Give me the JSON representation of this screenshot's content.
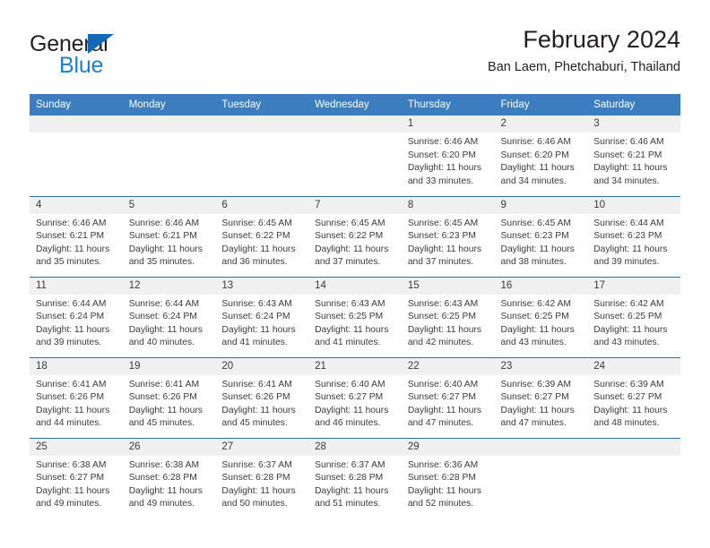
{
  "brand": {
    "name_top": "General",
    "name_bottom": "Blue",
    "accent_color": "#1b7fd4",
    "triangle_color": "#1268b3"
  },
  "header": {
    "title": "February 2024",
    "subtitle": "Ban Laem, Phetchaburi, Thailand"
  },
  "theme": {
    "header_row_bg": "#3b7dbf",
    "row_divider": "#2e6fa8",
    "daynum_bg": "#f0f0f0",
    "text": "#3a3a3a"
  },
  "weekday_headers": [
    "Sunday",
    "Monday",
    "Tuesday",
    "Wednesday",
    "Thursday",
    "Friday",
    "Saturday"
  ],
  "weeks": [
    [
      {
        "day": "",
        "blank": true
      },
      {
        "day": "",
        "blank": true
      },
      {
        "day": "",
        "blank": true
      },
      {
        "day": "",
        "blank": true
      },
      {
        "day": "1",
        "sunrise": "Sunrise: 6:46 AM",
        "sunset": "Sunset: 6:20 PM",
        "daylight": "Daylight: 11 hours and 33 minutes."
      },
      {
        "day": "2",
        "sunrise": "Sunrise: 6:46 AM",
        "sunset": "Sunset: 6:20 PM",
        "daylight": "Daylight: 11 hours and 34 minutes."
      },
      {
        "day": "3",
        "sunrise": "Sunrise: 6:46 AM",
        "sunset": "Sunset: 6:21 PM",
        "daylight": "Daylight: 11 hours and 34 minutes."
      }
    ],
    [
      {
        "day": "4",
        "sunrise": "Sunrise: 6:46 AM",
        "sunset": "Sunset: 6:21 PM",
        "daylight": "Daylight: 11 hours and 35 minutes."
      },
      {
        "day": "5",
        "sunrise": "Sunrise: 6:46 AM",
        "sunset": "Sunset: 6:21 PM",
        "daylight": "Daylight: 11 hours and 35 minutes."
      },
      {
        "day": "6",
        "sunrise": "Sunrise: 6:45 AM",
        "sunset": "Sunset: 6:22 PM",
        "daylight": "Daylight: 11 hours and 36 minutes."
      },
      {
        "day": "7",
        "sunrise": "Sunrise: 6:45 AM",
        "sunset": "Sunset: 6:22 PM",
        "daylight": "Daylight: 11 hours and 37 minutes."
      },
      {
        "day": "8",
        "sunrise": "Sunrise: 6:45 AM",
        "sunset": "Sunset: 6:23 PM",
        "daylight": "Daylight: 11 hours and 37 minutes."
      },
      {
        "day": "9",
        "sunrise": "Sunrise: 6:45 AM",
        "sunset": "Sunset: 6:23 PM",
        "daylight": "Daylight: 11 hours and 38 minutes."
      },
      {
        "day": "10",
        "sunrise": "Sunrise: 6:44 AM",
        "sunset": "Sunset: 6:23 PM",
        "daylight": "Daylight: 11 hours and 39 minutes."
      }
    ],
    [
      {
        "day": "11",
        "sunrise": "Sunrise: 6:44 AM",
        "sunset": "Sunset: 6:24 PM",
        "daylight": "Daylight: 11 hours and 39 minutes."
      },
      {
        "day": "12",
        "sunrise": "Sunrise: 6:44 AM",
        "sunset": "Sunset: 6:24 PM",
        "daylight": "Daylight: 11 hours and 40 minutes."
      },
      {
        "day": "13",
        "sunrise": "Sunrise: 6:43 AM",
        "sunset": "Sunset: 6:24 PM",
        "daylight": "Daylight: 11 hours and 41 minutes."
      },
      {
        "day": "14",
        "sunrise": "Sunrise: 6:43 AM",
        "sunset": "Sunset: 6:25 PM",
        "daylight": "Daylight: 11 hours and 41 minutes."
      },
      {
        "day": "15",
        "sunrise": "Sunrise: 6:43 AM",
        "sunset": "Sunset: 6:25 PM",
        "daylight": "Daylight: 11 hours and 42 minutes."
      },
      {
        "day": "16",
        "sunrise": "Sunrise: 6:42 AM",
        "sunset": "Sunset: 6:25 PM",
        "daylight": "Daylight: 11 hours and 43 minutes."
      },
      {
        "day": "17",
        "sunrise": "Sunrise: 6:42 AM",
        "sunset": "Sunset: 6:25 PM",
        "daylight": "Daylight: 11 hours and 43 minutes."
      }
    ],
    [
      {
        "day": "18",
        "sunrise": "Sunrise: 6:41 AM",
        "sunset": "Sunset: 6:26 PM",
        "daylight": "Daylight: 11 hours and 44 minutes."
      },
      {
        "day": "19",
        "sunrise": "Sunrise: 6:41 AM",
        "sunset": "Sunset: 6:26 PM",
        "daylight": "Daylight: 11 hours and 45 minutes."
      },
      {
        "day": "20",
        "sunrise": "Sunrise: 6:41 AM",
        "sunset": "Sunset: 6:26 PM",
        "daylight": "Daylight: 11 hours and 45 minutes."
      },
      {
        "day": "21",
        "sunrise": "Sunrise: 6:40 AM",
        "sunset": "Sunset: 6:27 PM",
        "daylight": "Daylight: 11 hours and 46 minutes."
      },
      {
        "day": "22",
        "sunrise": "Sunrise: 6:40 AM",
        "sunset": "Sunset: 6:27 PM",
        "daylight": "Daylight: 11 hours and 47 minutes."
      },
      {
        "day": "23",
        "sunrise": "Sunrise: 6:39 AM",
        "sunset": "Sunset: 6:27 PM",
        "daylight": "Daylight: 11 hours and 47 minutes."
      },
      {
        "day": "24",
        "sunrise": "Sunrise: 6:39 AM",
        "sunset": "Sunset: 6:27 PM",
        "daylight": "Daylight: 11 hours and 48 minutes."
      }
    ],
    [
      {
        "day": "25",
        "sunrise": "Sunrise: 6:38 AM",
        "sunset": "Sunset: 6:27 PM",
        "daylight": "Daylight: 11 hours and 49 minutes."
      },
      {
        "day": "26",
        "sunrise": "Sunrise: 6:38 AM",
        "sunset": "Sunset: 6:28 PM",
        "daylight": "Daylight: 11 hours and 49 minutes."
      },
      {
        "day": "27",
        "sunrise": "Sunrise: 6:37 AM",
        "sunset": "Sunset: 6:28 PM",
        "daylight": "Daylight: 11 hours and 50 minutes."
      },
      {
        "day": "28",
        "sunrise": "Sunrise: 6:37 AM",
        "sunset": "Sunset: 6:28 PM",
        "daylight": "Daylight: 11 hours and 51 minutes."
      },
      {
        "day": "29",
        "sunrise": "Sunrise: 6:36 AM",
        "sunset": "Sunset: 6:28 PM",
        "daylight": "Daylight: 11 hours and 52 minutes."
      },
      {
        "day": "",
        "blank": true
      },
      {
        "day": "",
        "blank": true
      }
    ]
  ]
}
